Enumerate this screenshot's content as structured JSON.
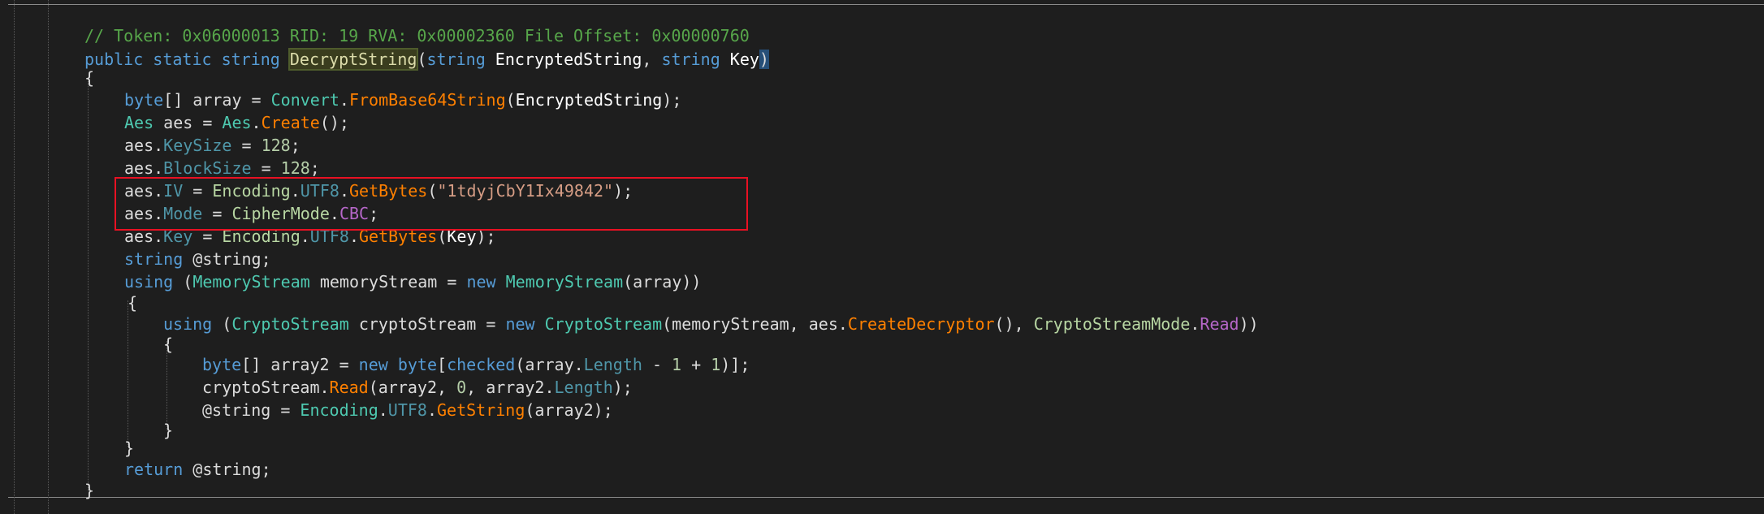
{
  "code_lines": [
    [
      {
        "t": "// Token: 0x06000013 RID: 19 RVA: 0x00002360 File Offset: 0x00000760",
        "c": "comment"
      }
    ],
    [
      {
        "t": "public",
        "c": "kw"
      },
      {
        "t": " ",
        "c": "plain"
      },
      {
        "t": "static",
        "c": "kw"
      },
      {
        "t": " ",
        "c": "plain"
      },
      {
        "t": "string",
        "c": "kw"
      },
      {
        "t": " ",
        "c": "plain"
      },
      {
        "t": "DecryptString",
        "c": "hl"
      },
      {
        "t": "(",
        "c": "plain"
      },
      {
        "t": "string",
        "c": "kw"
      },
      {
        "t": " ",
        "c": "plain"
      },
      {
        "t": "EncryptedString",
        "c": "param"
      },
      {
        "t": ", ",
        "c": "plain"
      },
      {
        "t": "string",
        "c": "kw"
      },
      {
        "t": " ",
        "c": "plain"
      },
      {
        "t": "Key",
        "c": "param"
      },
      {
        "t": ")",
        "c": "sel"
      }
    ],
    [
      {
        "t": "{",
        "c": "plain"
      }
    ],
    [
      {
        "t": "byte",
        "c": "kw"
      },
      {
        "t": "[] array = ",
        "c": "plain"
      },
      {
        "t": "Convert",
        "c": "type"
      },
      {
        "t": ".",
        "c": "plain"
      },
      {
        "t": "FromBase64String",
        "c": "method"
      },
      {
        "t": "(",
        "c": "plain"
      },
      {
        "t": "EncryptedString",
        "c": "param"
      },
      {
        "t": ");",
        "c": "plain"
      }
    ],
    [
      {
        "t": "Aes",
        "c": "type"
      },
      {
        "t": " aes = ",
        "c": "plain"
      },
      {
        "t": "Aes",
        "c": "type"
      },
      {
        "t": ".",
        "c": "plain"
      },
      {
        "t": "Create",
        "c": "method"
      },
      {
        "t": "();",
        "c": "plain"
      }
    ],
    [
      {
        "t": "aes.",
        "c": "plain"
      },
      {
        "t": "KeySize",
        "c": "prop"
      },
      {
        "t": " = ",
        "c": "plain"
      },
      {
        "t": "128",
        "c": "num"
      },
      {
        "t": ";",
        "c": "plain"
      }
    ],
    [
      {
        "t": "aes.",
        "c": "plain"
      },
      {
        "t": "BlockSize",
        "c": "prop"
      },
      {
        "t": " = ",
        "c": "plain"
      },
      {
        "t": "128",
        "c": "num"
      },
      {
        "t": ";",
        "c": "plain"
      }
    ],
    [
      {
        "t": "aes.",
        "c": "plain"
      },
      {
        "t": "IV",
        "c": "prop"
      },
      {
        "t": " = ",
        "c": "plain"
      },
      {
        "t": "Encoding",
        "c": "enum"
      },
      {
        "t": ".",
        "c": "plain"
      },
      {
        "t": "UTF8",
        "c": "prop"
      },
      {
        "t": ".",
        "c": "plain"
      },
      {
        "t": "GetBytes",
        "c": "method"
      },
      {
        "t": "(",
        "c": "plain"
      },
      {
        "t": "\"1tdyjCbY1Ix49842\"",
        "c": "str"
      },
      {
        "t": ");",
        "c": "plain"
      }
    ],
    [
      {
        "t": "aes.",
        "c": "plain"
      },
      {
        "t": "Mode",
        "c": "prop"
      },
      {
        "t": " = ",
        "c": "plain"
      },
      {
        "t": "CipherMode",
        "c": "enum"
      },
      {
        "t": ".",
        "c": "plain"
      },
      {
        "t": "CBC",
        "c": "enumm"
      },
      {
        "t": ";",
        "c": "plain"
      }
    ],
    [
      {
        "t": "aes.",
        "c": "plain"
      },
      {
        "t": "Key",
        "c": "prop"
      },
      {
        "t": " = ",
        "c": "plain"
      },
      {
        "t": "Encoding",
        "c": "enum"
      },
      {
        "t": ".",
        "c": "plain"
      },
      {
        "t": "UTF8",
        "c": "prop"
      },
      {
        "t": ".",
        "c": "plain"
      },
      {
        "t": "GetBytes",
        "c": "method"
      },
      {
        "t": "(",
        "c": "plain"
      },
      {
        "t": "Key",
        "c": "param"
      },
      {
        "t": ");",
        "c": "plain"
      }
    ],
    [
      {
        "t": "string",
        "c": "kw"
      },
      {
        "t": " @string;",
        "c": "plain"
      }
    ],
    [
      {
        "t": "using",
        "c": "kw"
      },
      {
        "t": " (",
        "c": "plain"
      },
      {
        "t": "MemoryStream",
        "c": "type"
      },
      {
        "t": " memoryStream = ",
        "c": "plain"
      },
      {
        "t": "new",
        "c": "kw"
      },
      {
        "t": " ",
        "c": "plain"
      },
      {
        "t": "MemoryStream",
        "c": "type"
      },
      {
        "t": "(array))",
        "c": "plain"
      }
    ],
    [
      {
        "t": "{",
        "c": "plain"
      }
    ],
    [
      {
        "t": "using",
        "c": "kw"
      },
      {
        "t": " (",
        "c": "plain"
      },
      {
        "t": "CryptoStream",
        "c": "type"
      },
      {
        "t": " cryptoStream = ",
        "c": "plain"
      },
      {
        "t": "new",
        "c": "kw"
      },
      {
        "t": " ",
        "c": "plain"
      },
      {
        "t": "CryptoStream",
        "c": "type"
      },
      {
        "t": "(memoryStream, aes.",
        "c": "plain"
      },
      {
        "t": "CreateDecryptor",
        "c": "method"
      },
      {
        "t": "(), ",
        "c": "plain"
      },
      {
        "t": "CryptoStreamMode",
        "c": "enum"
      },
      {
        "t": ".",
        "c": "plain"
      },
      {
        "t": "Read",
        "c": "enumm"
      },
      {
        "t": "))",
        "c": "plain"
      }
    ],
    [
      {
        "t": "{",
        "c": "plain"
      }
    ],
    [
      {
        "t": "byte",
        "c": "kw"
      },
      {
        "t": "[] array2 = ",
        "c": "plain"
      },
      {
        "t": "new",
        "c": "kw"
      },
      {
        "t": " ",
        "c": "plain"
      },
      {
        "t": "byte",
        "c": "kw"
      },
      {
        "t": "[",
        "c": "plain"
      },
      {
        "t": "checked",
        "c": "kw"
      },
      {
        "t": "(array.",
        "c": "plain"
      },
      {
        "t": "Length",
        "c": "prop"
      },
      {
        "t": " - ",
        "c": "plain"
      },
      {
        "t": "1",
        "c": "num"
      },
      {
        "t": " + ",
        "c": "plain"
      },
      {
        "t": "1",
        "c": "num"
      },
      {
        "t": ")];",
        "c": "plain"
      }
    ],
    [
      {
        "t": "cryptoStream.",
        "c": "plain"
      },
      {
        "t": "Read",
        "c": "method"
      },
      {
        "t": "(array2, ",
        "c": "plain"
      },
      {
        "t": "0",
        "c": "num"
      },
      {
        "t": ", array2.",
        "c": "plain"
      },
      {
        "t": "Length",
        "c": "prop"
      },
      {
        "t": ");",
        "c": "plain"
      }
    ],
    [
      {
        "t": "@string = ",
        "c": "plain"
      },
      {
        "t": "Encoding",
        "c": "type"
      },
      {
        "t": ".",
        "c": "plain"
      },
      {
        "t": "UTF8",
        "c": "prop"
      },
      {
        "t": ".",
        "c": "plain"
      },
      {
        "t": "GetString",
        "c": "method"
      },
      {
        "t": "(array2);",
        "c": "plain"
      }
    ],
    [
      {
        "t": "}",
        "c": "plain"
      }
    ],
    [
      {
        "t": "}",
        "c": "plain"
      }
    ],
    [
      {
        "t": "return",
        "c": "kw"
      },
      {
        "t": " @string;",
        "c": "plain"
      }
    ],
    [
      {
        "t": "}",
        "c": "plain"
      }
    ]
  ],
  "colors": {
    "background": "#1e1e1e",
    "highlight_box": "#e81123"
  }
}
